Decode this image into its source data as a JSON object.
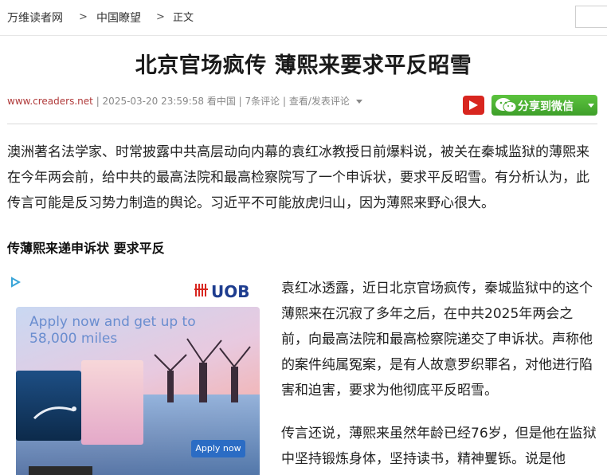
{
  "breadcrumb": {
    "items": [
      "万维读者网",
      "中国瞭望",
      "正文"
    ],
    "separator": ">"
  },
  "article": {
    "title": "北京官场疯传 薄熙来要求平反昭雪",
    "meta": {
      "site": "www.creaders.net",
      "date": "2025-03-20 23:59:58",
      "source": "看中国",
      "comments": "7条评论",
      "view_post": "查看/发表评论"
    },
    "share_label": "分享到微信",
    "paragraph1": "澳洲著名法学家、时常披露中共高层动向内幕的袁红冰教授日前爆料说，被关在秦城监狱的薄熙来在今年两会前，给中共的最高法院和最高检察院写了一个申诉状，要求平反昭雪。有分析认为，此传言可能是反习势力制造的舆论。习近平不可能放虎归山，因为薄熙来野心很大。",
    "subheading": "传薄熙来递申诉状 要求平反",
    "paragraph2": "袁红冰透露，近日北京官场疯传，秦城监狱中的这个薄熙来在沉寂了多年之后，在中共2025年两会之前，向最高法院和最高检察院递交了申诉状。声称他的案件纯属冤案，是有人故意罗织罪名，对他进行陷害和迫害，要求为他彻底平反昭雪。",
    "paragraph3": "传言还说，薄熙来虽然年龄已经76岁，但是他在监狱中坚持锻炼身体，坚持读书，精神矍铄。说是他"
  },
  "ad": {
    "brand": "UOB",
    "headline1": "Apply now and get up to",
    "headline2": "58,000 miles",
    "cta": "Apply now"
  },
  "colors": {
    "accent_red": "#d8261f",
    "wechat_green": "#4caf35",
    "uob_blue": "#1e3d8f"
  }
}
